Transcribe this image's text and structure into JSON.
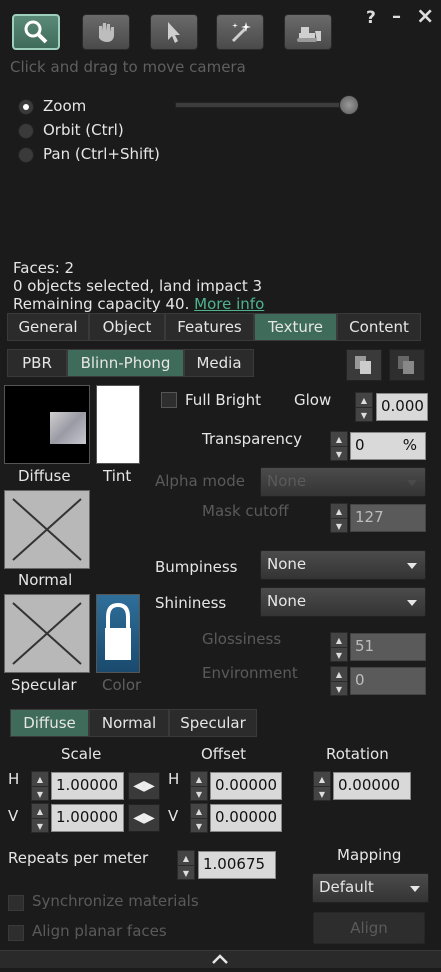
{
  "window": {
    "help": "?",
    "minimize": "–",
    "close": "×"
  },
  "toolbar": {
    "tools": [
      "zoom-tool",
      "grab-tool",
      "select-tool",
      "create-tool",
      "land-tool"
    ]
  },
  "camera": {
    "hint": "Click and drag to move camera",
    "options": [
      {
        "label": "Zoom",
        "selected": true
      },
      {
        "label": "Orbit (Ctrl)",
        "selected": false
      },
      {
        "label": "Pan (Ctrl+Shift)",
        "selected": false
      }
    ],
    "slider_level": 1.0
  },
  "info": {
    "faces": "Faces: 2",
    "selected": "0 objects selected, land impact 3",
    "capacity": "Remaining capacity 40.",
    "more_info": "More info"
  },
  "main_tabs": [
    "General",
    "Object",
    "Features",
    "Texture",
    "Content"
  ],
  "main_tab_selected": "Texture",
  "material_tabs": [
    "PBR",
    "Blinn-Phong",
    "Media"
  ],
  "material_tab_selected": "Blinn-Phong",
  "swatches": {
    "diffuse": "Diffuse",
    "tint": "Tint",
    "normal": "Normal",
    "specular": "Specular",
    "color": "Color"
  },
  "props": {
    "full_bright": "Full Bright",
    "glow_label": "Glow",
    "glow_value": "0.000",
    "transparency_label": "Transparency",
    "transparency_value": "0",
    "transparency_unit": "%",
    "alpha_mode_label": "Alpha mode",
    "alpha_mode_value": "None",
    "mask_cutoff_label": "Mask cutoff",
    "mask_cutoff_value": "127",
    "bumpiness_label": "Bumpiness",
    "bumpiness_value": "None",
    "shininess_label": "Shininess",
    "shininess_value": "None",
    "glossiness_label": "Glossiness",
    "glossiness_value": "51",
    "environment_label": "Environment",
    "environment_value": "0"
  },
  "map_tabs": [
    "Diffuse",
    "Normal",
    "Specular"
  ],
  "map_tab_selected": "Diffuse",
  "transform": {
    "scale_label": "Scale",
    "offset_label": "Offset",
    "rotation_label": "Rotation",
    "h": "H",
    "v": "V",
    "scale_h": "1.00000",
    "scale_v": "1.00000",
    "offset_h": "0.00000",
    "offset_v": "0.00000",
    "rotation": "0.00000"
  },
  "repeats": {
    "label": "Repeats per meter",
    "value": "1.00675",
    "mapping_label": "Mapping",
    "mapping_value": "Default"
  },
  "footer": {
    "sync": "Synchronize materials",
    "align_planar": "Align planar faces",
    "align_button": "Align"
  },
  "colors": {
    "accent": "#3f6b5b",
    "link": "#4fb38f",
    "background": "#1b1b1b"
  }
}
